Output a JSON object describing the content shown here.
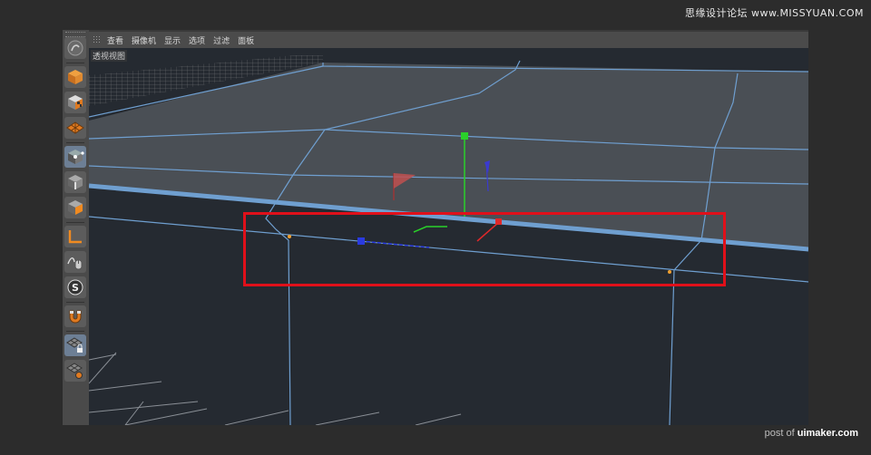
{
  "watermark": {
    "site": "思缘设计论坛 www.MISSYUAN.COM",
    "post_prefix": "post of",
    "post_brand": "uimaker.com"
  },
  "menubar": {
    "items": [
      "查看",
      "摄像机",
      "显示",
      "选项",
      "过滤",
      "面板"
    ]
  },
  "viewport": {
    "label": "透视视图"
  },
  "toolbar": {
    "tools": [
      {
        "icon": "cinema4d-logo-icon",
        "active": false
      },
      {
        "icon": "cube-object-icon",
        "active": false
      },
      {
        "icon": "checker-cube-icon",
        "active": false
      },
      {
        "icon": "polygon-grid-icon",
        "active": false
      },
      {
        "icon": "points-mode-icon",
        "active": true
      },
      {
        "icon": "edges-mode-icon",
        "active": false
      },
      {
        "icon": "polygons-mode-icon",
        "active": false
      },
      {
        "icon": "axis-mode-icon",
        "active": false
      },
      {
        "icon": "tweak-mode-icon",
        "active": false
      },
      {
        "icon": "snap-icon",
        "active": false
      },
      {
        "icon": "magnet-icon",
        "active": false
      },
      {
        "icon": "workplane-lock-icon",
        "active": true
      },
      {
        "icon": "workplane-icon",
        "active": false
      }
    ]
  },
  "colors": {
    "highlight": "#e0101a",
    "active_tool": "#6d7f95",
    "edge_line": "#6f9fd0",
    "axis_x": "#e0282a",
    "axis_y": "#2ad12a",
    "axis_z": "#2a3ae0"
  }
}
